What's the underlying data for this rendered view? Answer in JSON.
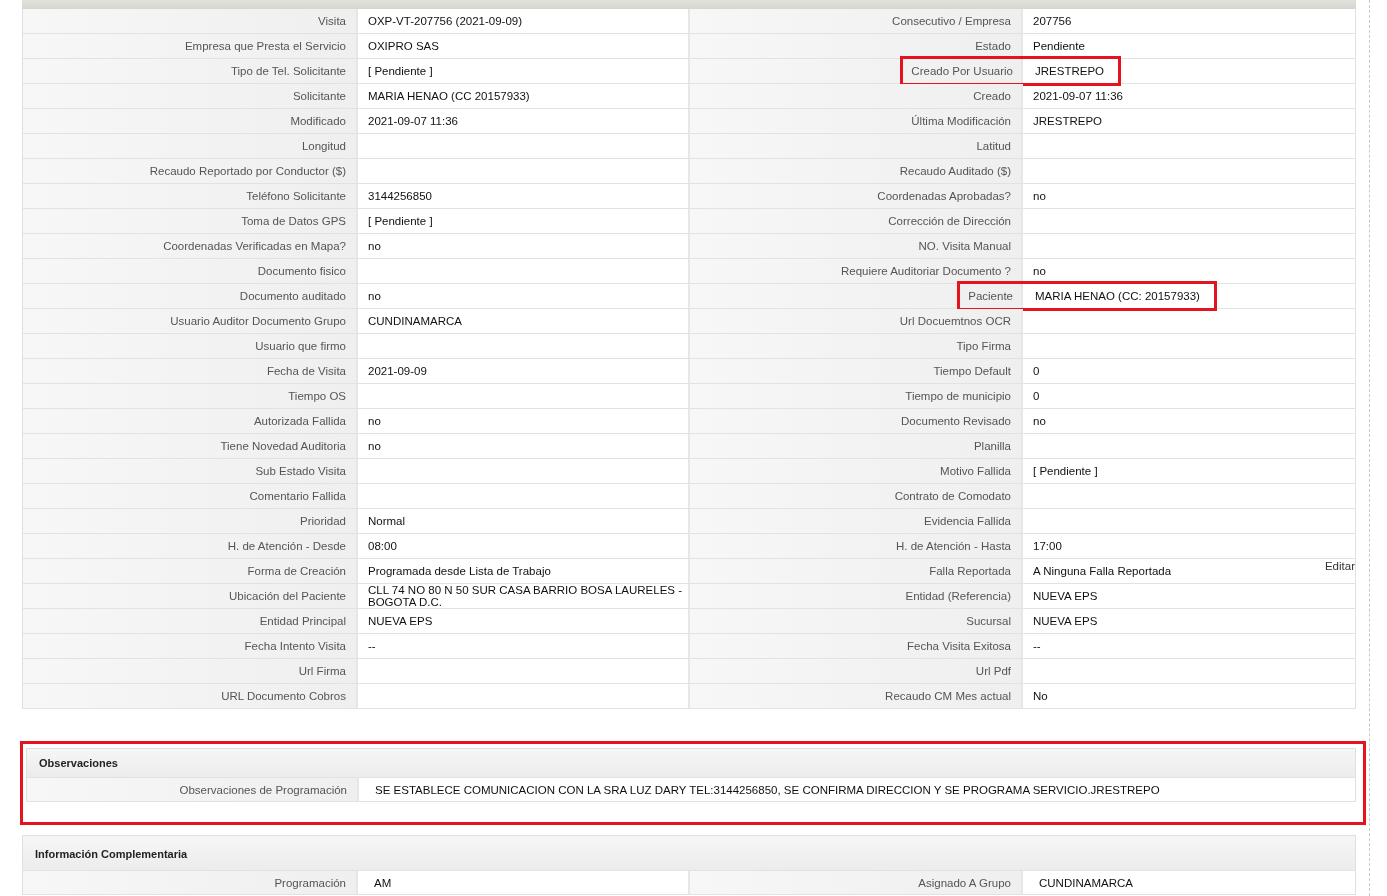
{
  "main_table": {
    "rows": [
      {
        "cells": [
          {
            "label": "Visita",
            "value": "OXP-VT-207756 (2021-09-09)"
          },
          {
            "label": "Consecutivo / Empresa",
            "value": "207756"
          }
        ]
      },
      {
        "cells": [
          {
            "label": "Empresa que Presta el Servicio",
            "value": "OXIPRO SAS"
          },
          {
            "label": "Estado",
            "value": "Pendiente"
          }
        ]
      },
      {
        "cells": [
          {
            "label": "Tipo de Tel. Solicitante",
            "value": "[ Pendiente ]"
          },
          {
            "label": "Creado Por Usuario",
            "value": "JRESTREPO",
            "highlighted": true
          }
        ]
      },
      {
        "cells": [
          {
            "label": "Solicitante",
            "value": "MARIA HENAO (CC 20157933)"
          },
          {
            "label": "Creado",
            "value": "2021-09-07 11:36"
          }
        ]
      },
      {
        "cells": [
          {
            "label": "Modificado",
            "value": "2021-09-07 11:36"
          },
          {
            "label": "Última Modificación",
            "value": "JRESTREPO"
          }
        ]
      },
      {
        "cells": [
          {
            "label": "Longitud"
          },
          {
            "label": "Latitud"
          }
        ]
      },
      {
        "cells": [
          {
            "label": "Recaudo Reportado por Conductor ($)"
          },
          {
            "label": "Recaudo Auditado ($)"
          }
        ]
      },
      {
        "cells": [
          {
            "label": "Teléfono Solicitante",
            "value": "3144256850"
          },
          {
            "label": "Coordenadas Aprobadas?",
            "value": "no"
          }
        ]
      },
      {
        "cells": [
          {
            "label": "Toma de Datos GPS",
            "value": "[ Pendiente ]"
          },
          {
            "label": "Corrección de Dirección"
          }
        ]
      },
      {
        "cells": [
          {
            "label": "Coordenadas Verificadas en Mapa?",
            "value": "no"
          },
          {
            "label": "NO. Visita Manual"
          }
        ]
      },
      {
        "cells": [
          {
            "label": "Documento fisico"
          },
          {
            "label": "Requiere Auditoriar Documento ?",
            "value": "no"
          }
        ]
      },
      {
        "cells": [
          {
            "label": "Documento auditado",
            "value": "no"
          },
          {
            "label": "Paciente",
            "value": "MARIA HENAO (CC: 20157933)",
            "highlighted": true
          }
        ]
      },
      {
        "cells": [
          {
            "label": "Usuario Auditor Documento Grupo",
            "value": "CUNDINAMARCA"
          },
          {
            "label": "Url Docuemtnos OCR"
          }
        ]
      },
      {
        "cells": [
          {
            "label": "Usuario que firmo"
          },
          {
            "label": "Tipo Firma"
          }
        ]
      },
      {
        "cells": [
          {
            "label": "Fecha de Visita",
            "value": "2021-09-09"
          },
          {
            "label": "Tiempo Default",
            "value": "0"
          }
        ]
      },
      {
        "cells": [
          {
            "label": "Tiempo OS"
          },
          {
            "label": "Tiempo de municipio",
            "value": "0"
          }
        ]
      },
      {
        "cells": [
          {
            "label": "Autorizada Fallida",
            "value": "no"
          },
          {
            "label": "Documento Revisado",
            "value": "no"
          }
        ]
      },
      {
        "cells": [
          {
            "label": "Tiene Novedad Auditoria",
            "value": "no"
          },
          {
            "label": "Planilla"
          }
        ]
      },
      {
        "cells": [
          {
            "label": "Sub Estado Visita"
          },
          {
            "label": "Motivo Fallida",
            "value": "[ Pendiente ]"
          }
        ]
      },
      {
        "cells": [
          {
            "label": "Comentario Fallida"
          },
          {
            "label": "Contrato de Comodato"
          }
        ]
      },
      {
        "cells": [
          {
            "label": "Prioridad",
            "value": "Normal"
          },
          {
            "label": "Evidencia Fallida"
          }
        ]
      },
      {
        "cells": [
          {
            "label": "H. de Atención - Desde",
            "value": "08:00"
          },
          {
            "label": "H. de Atención - Hasta",
            "value": "17:00"
          }
        ]
      },
      {
        "cells": [
          {
            "label": "Forma de Creación",
            "value": "Programada desde Lista de Trabajo"
          },
          {
            "label": "Falla Reportada",
            "value": "A Ninguna Falla Reportada",
            "action": "Editar"
          }
        ]
      },
      {
        "cells": [
          {
            "label": "Ubicación del Paciente",
            "value": "CLL 74 NO 80 N 50 SUR CASA BARRIO BOSA LAURELES - BOGOTA D.C."
          },
          {
            "label": "Entidad (Referencia)",
            "value": "NUEVA EPS"
          }
        ]
      },
      {
        "cells": [
          {
            "label": "Entidad Principal",
            "value": "NUEVA EPS"
          },
          {
            "label": "Sucursal",
            "value": "NUEVA EPS"
          }
        ]
      },
      {
        "cells": [
          {
            "label": "Fecha Intento Visita",
            "value": "--"
          },
          {
            "label": "Fecha Visita Exitosa",
            "value": "--"
          }
        ]
      },
      {
        "cells": [
          {
            "label": "Url Firma"
          },
          {
            "label": "Url Pdf"
          }
        ]
      },
      {
        "cells": [
          {
            "label": "URL Documento Cobros"
          },
          {
            "label": "Recaudo CM Mes actual",
            "value": "No"
          }
        ]
      }
    ]
  },
  "sections": [
    {
      "title": "Observaciones",
      "highlighted": true,
      "rows": [
        {
          "cells": [
            {
              "label": "Observaciones de Programación",
              "value": "SE ESTABLECE COMUNICACION CON LA SRA LUZ DARY TEL:3144256850, SE CONFIRMA DIRECCION Y SE PROGRAMA SERVICIO.JRESTREPO"
            }
          ]
        }
      ]
    },
    {
      "title": "Información Complementaria",
      "rows": [
        {
          "cells": [
            {
              "label": "Programación",
              "value": "AM"
            },
            {
              "label": "Asignado A Grupo",
              "value": "CUNDINAMARCA"
            }
          ]
        }
      ]
    }
  ]
}
